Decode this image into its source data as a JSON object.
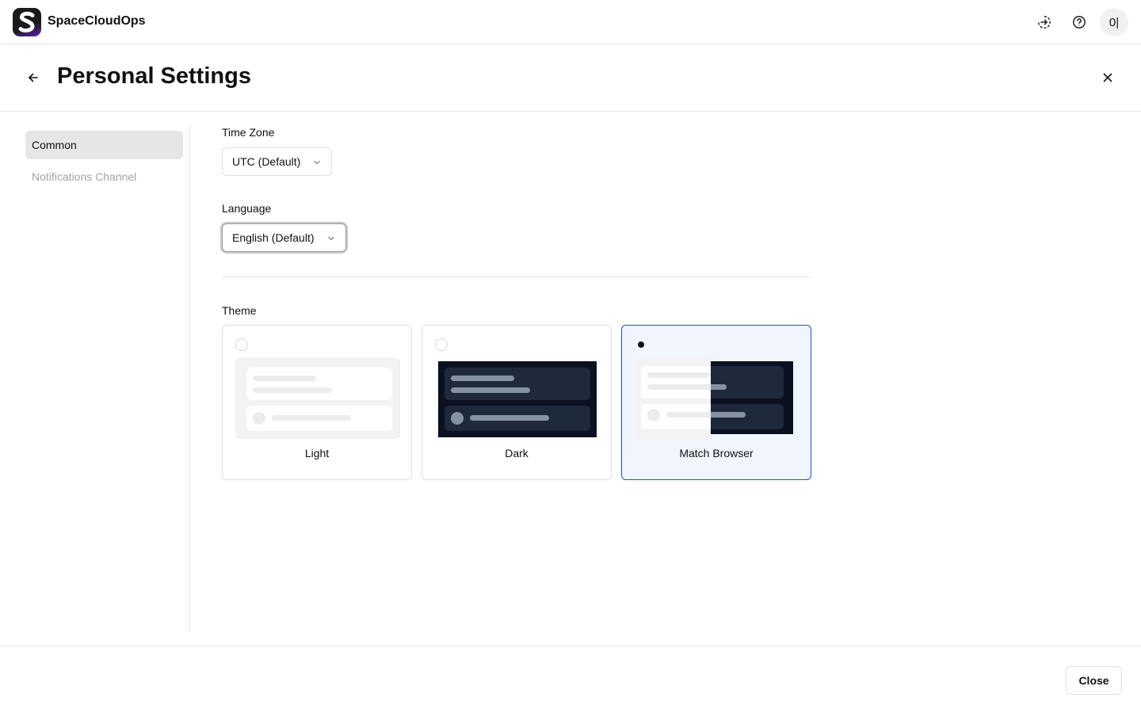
{
  "app": {
    "brand": "SpaceCloudOps"
  },
  "topbar": {
    "icons": [
      "sign-in-icon",
      "help-icon"
    ],
    "avatar_text": "0|"
  },
  "header": {
    "title": "Personal Settings"
  },
  "sidenav": {
    "items": [
      {
        "label": "Common",
        "active": true
      },
      {
        "label": "Notifications Channel",
        "active": false
      }
    ]
  },
  "settings": {
    "timezone": {
      "label": "Time Zone",
      "value": "UTC (Default)"
    },
    "language": {
      "label": "Language",
      "value": "English (Default)"
    },
    "theme": {
      "label": "Theme",
      "options": [
        {
          "name": "Light",
          "selected": false
        },
        {
          "name": "Dark",
          "selected": false
        },
        {
          "name": "Match Browser",
          "selected": true
        }
      ]
    }
  },
  "footer": {
    "close_label": "Close"
  },
  "colors": {
    "accent": "#1d4ed8",
    "selected_bg": "#f1f6fe",
    "dark_preview_bg": "#0b1120",
    "dark_preview_card": "#1e293b",
    "dark_preview_bar": "#8492a6"
  }
}
